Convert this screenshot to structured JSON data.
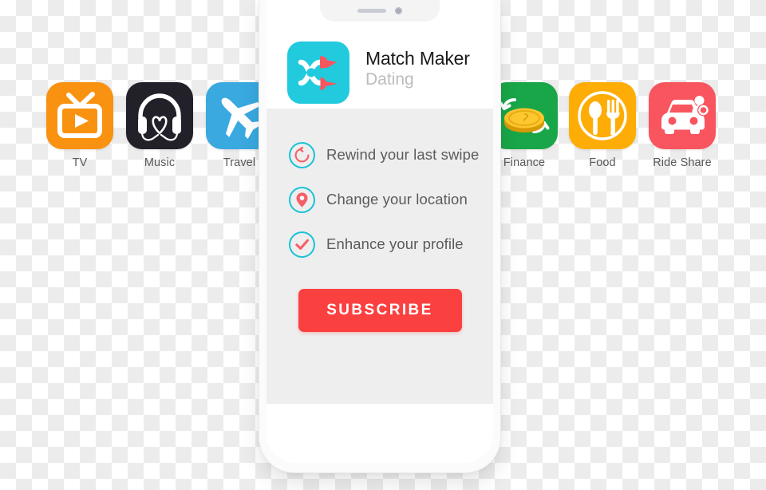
{
  "app_strip": {
    "items": [
      {
        "label": "TV",
        "icon": "tv-icon",
        "bg": "#f99211",
        "fg": "#ffffff"
      },
      {
        "label": "Music",
        "icon": "headphones-icon",
        "bg": "#22212a",
        "fg": "#ffffff"
      },
      {
        "label": "Travel",
        "icon": "airplane-icon",
        "bg": "#39a9e0",
        "fg": "#ffffff"
      },
      {
        "label": "Finance",
        "icon": "coin-icon",
        "bg": "#18a648",
        "fg": "#fdc72e"
      },
      {
        "label": "Food",
        "icon": "cutlery-icon",
        "bg": "#fdad06",
        "fg": "#ffffff"
      },
      {
        "label": "Ride Share",
        "icon": "car-icon",
        "bg": "#f9555f",
        "fg": "#ffffff"
      }
    ]
  },
  "phone": {
    "notch": {
      "speaker": "speaker-grille-icon",
      "camera": "front-camera-icon"
    },
    "brand": {
      "logo_icon": "shuffle-hearts-icon",
      "title": "Match Maker",
      "subtitle": "Dating",
      "logo_bg": "#21cadd",
      "logo_accent": "#f8565e"
    },
    "features": [
      {
        "icon": "rewind-icon",
        "label": "Rewind your last swipe"
      },
      {
        "icon": "location-pin-icon",
        "label": "Change your location"
      },
      {
        "icon": "check-circle-icon",
        "label": "Enhance your profile"
      }
    ],
    "cta": {
      "label": "SUBSCRIBE",
      "color": "#fb4040",
      "text_color": "#ffffff"
    }
  },
  "colors": {
    "feature_ring": "#17c3d8",
    "feature_glyph": "#f4606a",
    "screen_body_bg": "#eeeeee",
    "label_text": "#58595b"
  }
}
